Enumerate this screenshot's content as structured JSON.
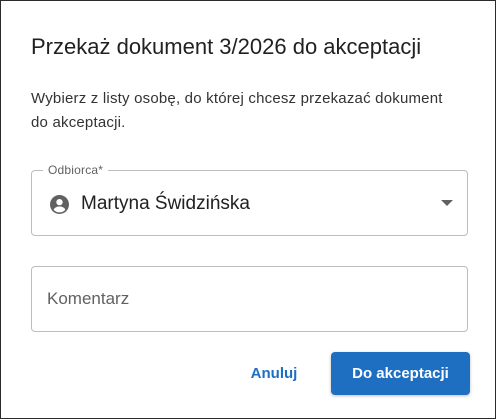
{
  "dialog": {
    "title": "Przekaż dokument 3/2026 do akceptacji",
    "description": "Wybierz z listy osobę, do której chcesz przekazać dokument do akceptacji."
  },
  "recipient_field": {
    "label": "Odbiorca*",
    "selected_value": "Martyna Świdzińska",
    "icon": "person-circle-icon"
  },
  "comment_field": {
    "placeholder": "Komentarz",
    "value": ""
  },
  "actions": {
    "cancel_label": "Anuluj",
    "submit_label": "Do akceptacji"
  },
  "colors": {
    "primary": "#1e6fc2",
    "border": "#bdbdbd",
    "text": "#212121"
  }
}
